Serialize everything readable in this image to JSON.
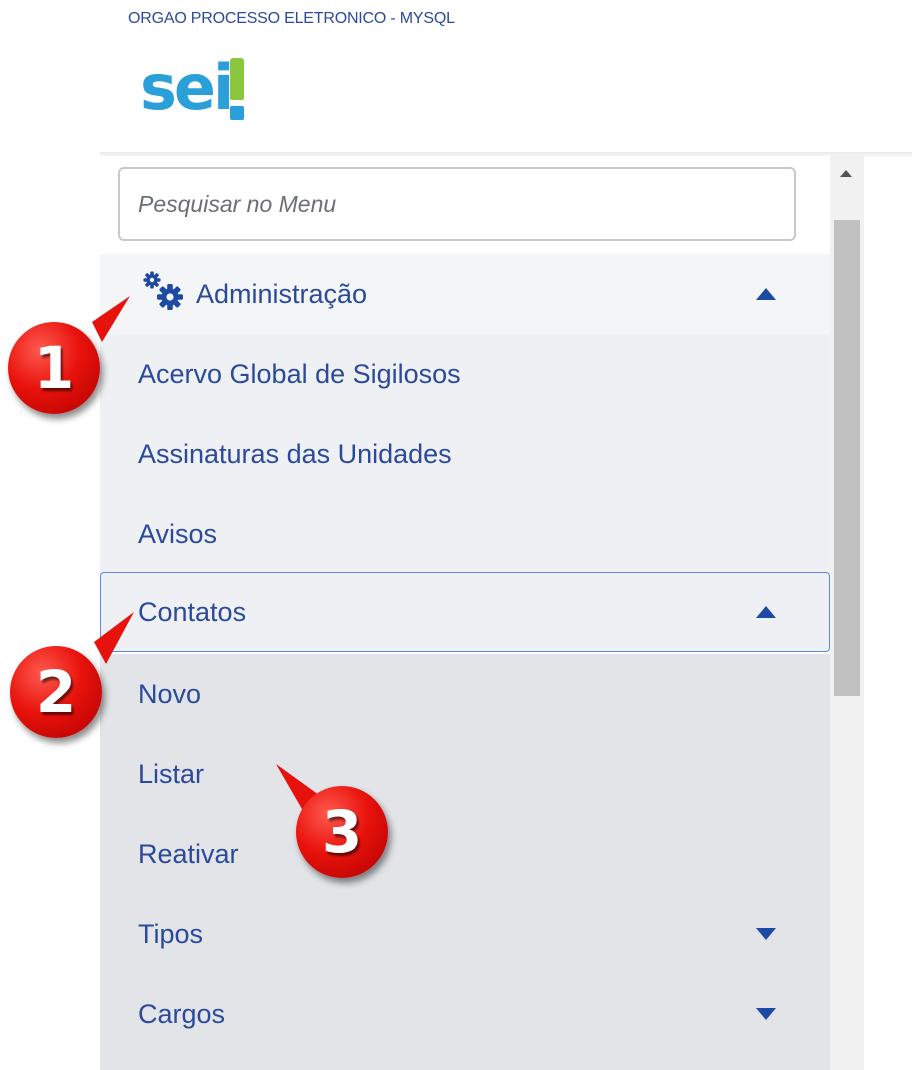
{
  "header": {
    "org_name": "ORGAO PROCESSO ELETRONICO - MYSQL",
    "logo_text": "sei"
  },
  "search": {
    "placeholder": "Pesquisar no Menu"
  },
  "menu": {
    "admin_label": "Administração",
    "level1": [
      "Acervo Global de Sigilosos",
      "Assinaturas das Unidades",
      "Avisos"
    ],
    "contatos_label": "Contatos",
    "contatos_children": [
      "Novo",
      "Listar",
      "Reativar",
      "Tipos",
      "Cargos"
    ]
  },
  "annotations": [
    "1",
    "2",
    "3"
  ],
  "colors": {
    "link_blue": "#2b4a9c",
    "logo_blue": "#2a9fd8",
    "logo_green": "#8cc63f",
    "callout_red": "#e8120c",
    "focus_border": "#5b8be0"
  },
  "icons": {
    "admin": "gears-icon",
    "expanded": "caret-up-icon",
    "collapsed": "caret-down-icon"
  }
}
